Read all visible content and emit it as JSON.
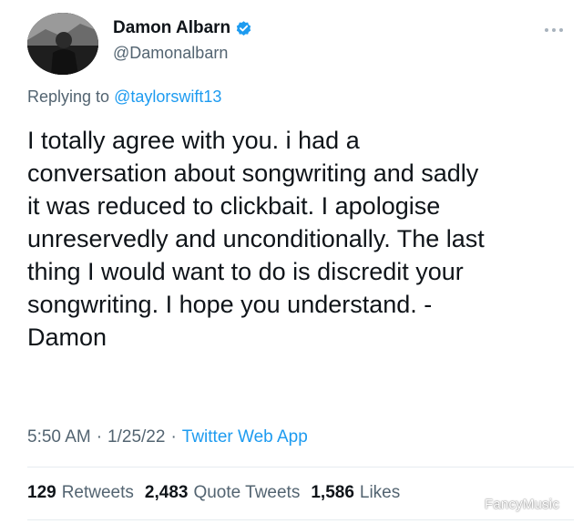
{
  "author": {
    "display_name": "Damon Albarn",
    "handle": "@Damonalbarn",
    "verified": true
  },
  "reply": {
    "prefix": "Replying to",
    "mention": "@taylorswift13"
  },
  "tweet_text": "I totally agree with you. i had a\nconversation about songwriting and sadly\nit was reduced to clickbait. I apologise\nunreservedly and unconditionally. The last\nthing I would want to do is discredit your\nsongwriting. I hope you understand. -\nDamon",
  "meta": {
    "time": "5:50 AM",
    "date": "1/25/22",
    "source": "Twitter Web App",
    "separator": "·"
  },
  "stats": {
    "retweets": {
      "count": "129",
      "label": "Retweets"
    },
    "quote_tweets": {
      "count": "2,483",
      "label": "Quote Tweets"
    },
    "likes": {
      "count": "1,586",
      "label": "Likes"
    }
  },
  "watermark": "FancyMusic",
  "icons": {
    "verified": "verified-badge-icon",
    "more": "more-options-icon"
  },
  "colors": {
    "accent": "#1d9bf0",
    "secondary_text": "#536471",
    "primary_text": "#0f1419"
  }
}
